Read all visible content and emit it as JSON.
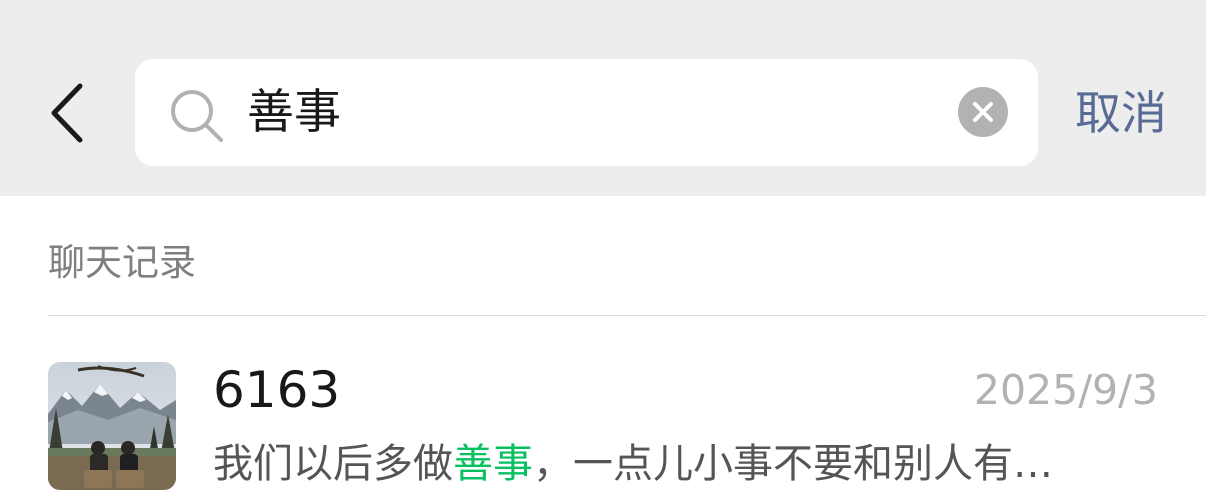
{
  "search": {
    "query": "善事",
    "cancel_label": "取消"
  },
  "section": {
    "title": "聊天记录"
  },
  "results": [
    {
      "title": "6163",
      "date": "2025/9/3",
      "snippet_before": "我们以后多做",
      "snippet_highlight": "善事",
      "snippet_after": "，一点儿小事不要和别人有…"
    }
  ],
  "colors": {
    "header_bg": "#ededed",
    "link": "#576b95",
    "highlight": "#07c160",
    "secondary_text": "#7f7f7f",
    "date_text": "#b2b2b2"
  },
  "icons": {
    "back": "chevron-left-icon",
    "search": "search-icon",
    "clear": "clear-circle-x-icon"
  }
}
